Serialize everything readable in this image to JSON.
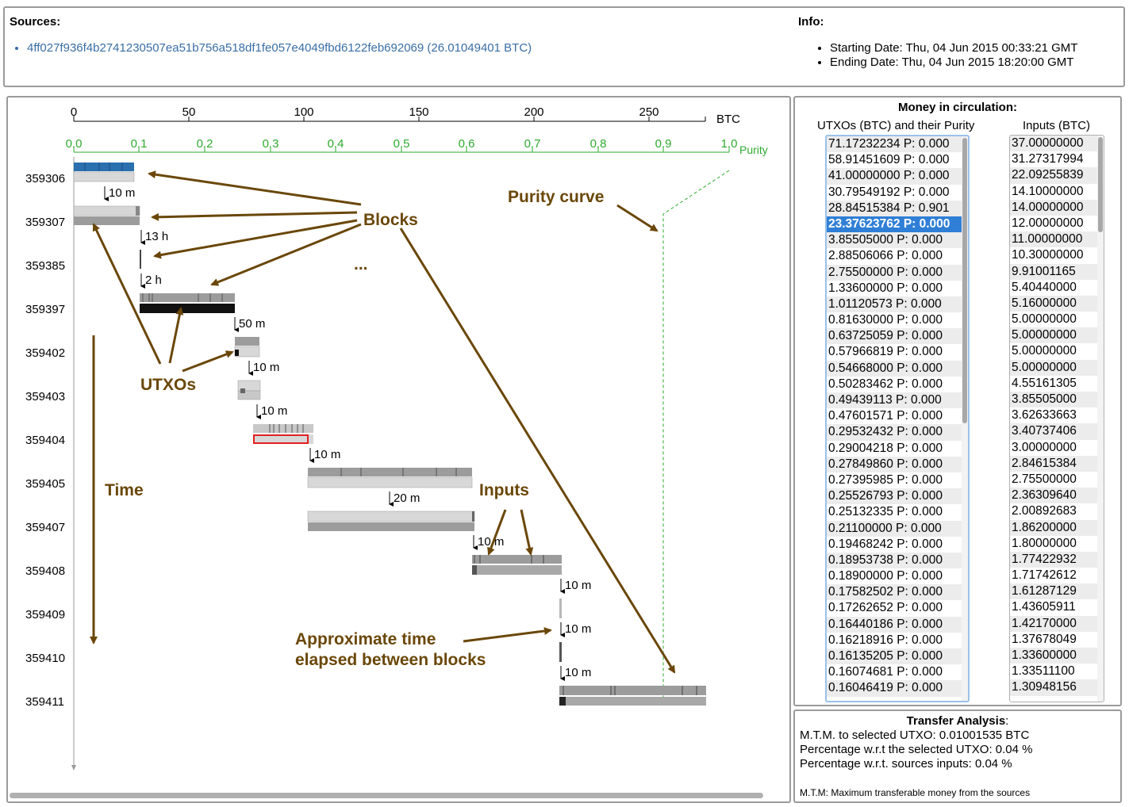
{
  "sources": {
    "title": "Sources:",
    "items": [
      "4ff027f936f4b2741230507ea51b756a518df1fe057e4049fbd6122feb692069 (26.01049401 BTC)"
    ]
  },
  "info": {
    "title": "Info:",
    "items": [
      "Starting Date: Thu, 04 Jun 2015 00:33:21 GMT",
      "Ending Date: Thu, 04 Jun 2015 18:20:00 GMT"
    ]
  },
  "viz": {
    "btc_axis": {
      "ticks": [
        "0",
        "50",
        "100",
        "150",
        "200",
        "250"
      ],
      "unit": "BTC"
    },
    "purity_axis": {
      "ticks": [
        "0.0",
        "0.1",
        "0.2",
        "0.3",
        "0.4",
        "0.5",
        "0.6",
        "0.7",
        "0.8",
        "0.9",
        "1.0"
      ],
      "label": "Purity"
    },
    "block_heights": [
      "359306",
      "359307",
      "359385",
      "359397",
      "359402",
      "359403",
      "359404",
      "359405",
      "359407",
      "359408",
      "359409",
      "359410",
      "359411"
    ],
    "intervals": [
      "10 m",
      "13 h",
      "2 h",
      "50 m",
      "10 m",
      "10 m",
      "10 m",
      "20 m",
      "10 m",
      "10 m",
      "10 m",
      "10 m"
    ],
    "annotations": {
      "blocks": "Blocks",
      "ellipsis": "...",
      "purity_curve": "Purity curve",
      "utxos": "UTXOs",
      "time": "Time",
      "inputs": "Inputs",
      "elapsed_line1": "Approximate time",
      "elapsed_line2": "elapsed between blocks"
    },
    "colors": {
      "purity": "#2eaa2e",
      "annotation": "#6a4708",
      "selected_utxo": "#e02020",
      "source_block": "#2a6fae"
    }
  },
  "money": {
    "title": "Money in circulation:",
    "utxo_header": "UTXOs (BTC) and their Purity",
    "inputs_header": "Inputs (BTC)",
    "selected_index": 5,
    "utxos": [
      "71.17232234 P: 0.000",
      "58.91451609 P: 0.000",
      "41.00000000 P: 0.000",
      "30.79549192 P: 0.000",
      "28.84515384 P: 0.901",
      "23.37623762 P: 0.000",
      "3.85505000 P: 0.000",
      "2.88506066 P: 0.000",
      "2.75500000 P: 0.000",
      "1.33600000 P: 0.000",
      "1.01120573 P: 0.000",
      "0.81630000 P: 0.000",
      "0.63725059 P: 0.000",
      "0.57966819 P: 0.000",
      "0.54668000 P: 0.000",
      "0.50283462 P: 0.000",
      "0.49439113 P: 0.000",
      "0.47601571 P: 0.000",
      "0.29532432 P: 0.000",
      "0.29004218 P: 0.000",
      "0.27849860 P: 0.000",
      "0.27395985 P: 0.000",
      "0.25526793 P: 0.000",
      "0.25132335 P: 0.000",
      "0.21100000 P: 0.000",
      "0.19468242 P: 0.000",
      "0.18953738 P: 0.000",
      "0.18900000 P: 0.000",
      "0.17582502 P: 0.000",
      "0.17262652 P: 0.000",
      "0.16440186 P: 0.000",
      "0.16218916 P: 0.000",
      "0.16135205 P: 0.000",
      "0.16074681 P: 0.000",
      "0.16046419 P: 0.000"
    ],
    "inputs": [
      "37.00000000",
      "31.27317994",
      "22.09255839",
      "14.10000000",
      "14.00000000",
      "12.00000000",
      "11.00000000",
      "10.30000000",
      "9.91001165",
      "5.40440000",
      "5.16000000",
      "5.00000000",
      "5.00000000",
      "5.00000000",
      "5.00000000",
      "4.55161305",
      "3.85505000",
      "3.62633663",
      "3.40737406",
      "3.00000000",
      "2.84615384",
      "2.75500000",
      "2.36309640",
      "2.00892683",
      "1.86200000",
      "1.80000000",
      "1.77422932",
      "1.71742612",
      "1.61287129",
      "1.43605911",
      "1.42170000",
      "1.37678049",
      "1.33600000",
      "1.33511100",
      "1.30948156"
    ]
  },
  "transfer": {
    "title": "Transfer Analysis",
    "title_colon": ":",
    "mtm_line": "M.T.M. to selected UTXO: 0.01001535 BTC",
    "pct_selected": "Percentage w.r.t the selected UTXO: 0.04 %",
    "pct_sources": "Percentage w.r.t. sources inputs: 0.04 %",
    "note": "M.T.M: Maximum transferable money from the sources"
  }
}
